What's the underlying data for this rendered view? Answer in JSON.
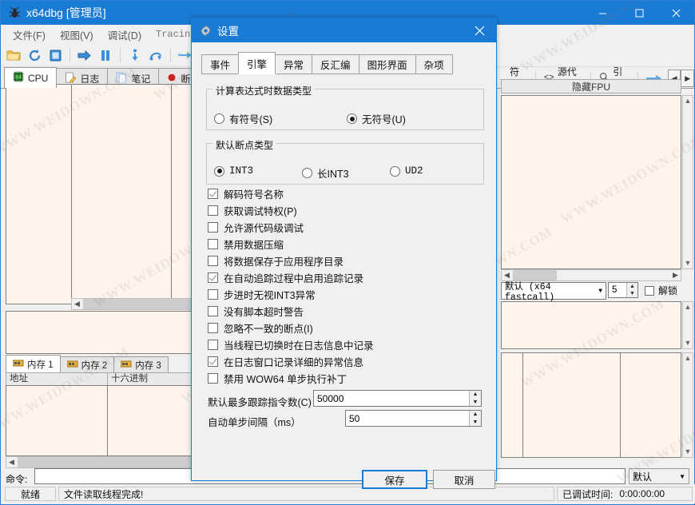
{
  "app": {
    "title": "x64dbg [管理员]",
    "icon": "bug-icon",
    "window_buttons": {
      "minimize": "—",
      "maximize": "☐",
      "close": "✕"
    },
    "menus": [
      "文件(F)",
      "视图(V)",
      "调试(D)",
      "Tracing"
    ],
    "toolbar_icons": [
      "open-folder-icon",
      "restart-icon",
      "stop-icon",
      "run-icon",
      "pause-icon",
      "step-into-icon",
      "step-over-icon",
      "step-out-icon",
      "run-to-icon"
    ],
    "tabs": [
      {
        "label": "CPU",
        "icon": "cpu-icon",
        "active": true
      },
      {
        "label": "日志",
        "icon": "log-icon",
        "active": false
      },
      {
        "label": "笔记",
        "icon": "notes-icon",
        "active": false
      },
      {
        "label": "断",
        "icon": "breakpoint-icon",
        "active": false
      }
    ],
    "right_toolbar": [
      {
        "label": "符号",
        "icon": "symbol-icon"
      },
      {
        "label": "源代码",
        "icon": "source-code-icon"
      },
      {
        "label": "引用",
        "icon": "search-icon"
      }
    ],
    "right_nav": {
      "jump_icon": "jump-arrow-icon",
      "prev": "◀",
      "next": "▶"
    },
    "fpu_button": "隐藏FPU",
    "callconv": {
      "value": "默认 (x64 fastcall)",
      "arrow": "▼"
    },
    "args_count": "5",
    "unlock_label": "解锁",
    "memory_tabs": [
      {
        "label": "内存 1",
        "icon": "memory-icon",
        "active": true
      },
      {
        "label": "内存 2",
        "icon": "memory-icon",
        "active": false
      },
      {
        "label": "内存 3",
        "icon": "memory-icon",
        "active": false
      }
    ],
    "memory_columns": [
      "地址",
      "十六进制"
    ],
    "command": {
      "label": "命令:",
      "value": "",
      "mode": "默认",
      "arrow": "▼"
    },
    "status": {
      "state": "就绪",
      "message": "文件读取线程完成!",
      "time_label": "已调试时间:",
      "time_value": "0:00:00:00"
    }
  },
  "dialog": {
    "title": "设置",
    "title_icon": "gear-icon",
    "close": "✕",
    "tabs": [
      {
        "label": "事件",
        "active": false
      },
      {
        "label": "引擎",
        "active": true
      },
      {
        "label": "异常",
        "active": false
      },
      {
        "label": "反汇编",
        "active": false
      },
      {
        "label": "图形界面",
        "active": false
      },
      {
        "label": "杂项",
        "active": false
      }
    ],
    "group_datatype": {
      "title": "计算表达式时数据类型",
      "options": [
        {
          "label": "有符号(S)",
          "checked": false
        },
        {
          "label": "无符号(U)",
          "checked": true
        }
      ]
    },
    "group_breakpoint": {
      "title": "默认断点类型",
      "options": [
        {
          "label": "INT3",
          "checked": true
        },
        {
          "label": "长INT3",
          "checked": false
        },
        {
          "label": "UD2",
          "checked": false
        }
      ]
    },
    "checkboxes": [
      {
        "label": "解码符号名称",
        "checked": true
      },
      {
        "label": "获取调试特权(P)",
        "checked": false
      },
      {
        "label": "允许源代码级调试",
        "checked": false
      },
      {
        "label": "禁用数据压缩",
        "checked": false
      },
      {
        "label": "将数据保存于应用程序目录",
        "checked": false
      },
      {
        "label": "在自动追踪过程中启用追踪记录",
        "checked": true
      },
      {
        "label": "步进时无视INT3异常",
        "checked": false
      },
      {
        "label": "没有脚本超时警告",
        "checked": false
      },
      {
        "label": "忽略不一致的断点(I)",
        "checked": false
      },
      {
        "label": "当线程已切换时在日志信息中记录",
        "checked": false
      },
      {
        "label": "在日志窗口记录详细的异常信息",
        "checked": true
      },
      {
        "label": "禁用 WOW64 单步执行补丁",
        "checked": false
      }
    ],
    "fields": [
      {
        "label": "默认最多跟踪指令数(C)",
        "value": "50000"
      },
      {
        "label": "自动单步间隔（ms）",
        "value": "50"
      }
    ],
    "buttons": {
      "save": "保存",
      "cancel": "取消"
    }
  },
  "watermark": {
    "text": "WWW.WEIDOWN.COM"
  },
  "colors": {
    "accent": "#1a7bd4",
    "pane_bg": "#fdf5ec",
    "chrome": "#f0f0f0"
  }
}
